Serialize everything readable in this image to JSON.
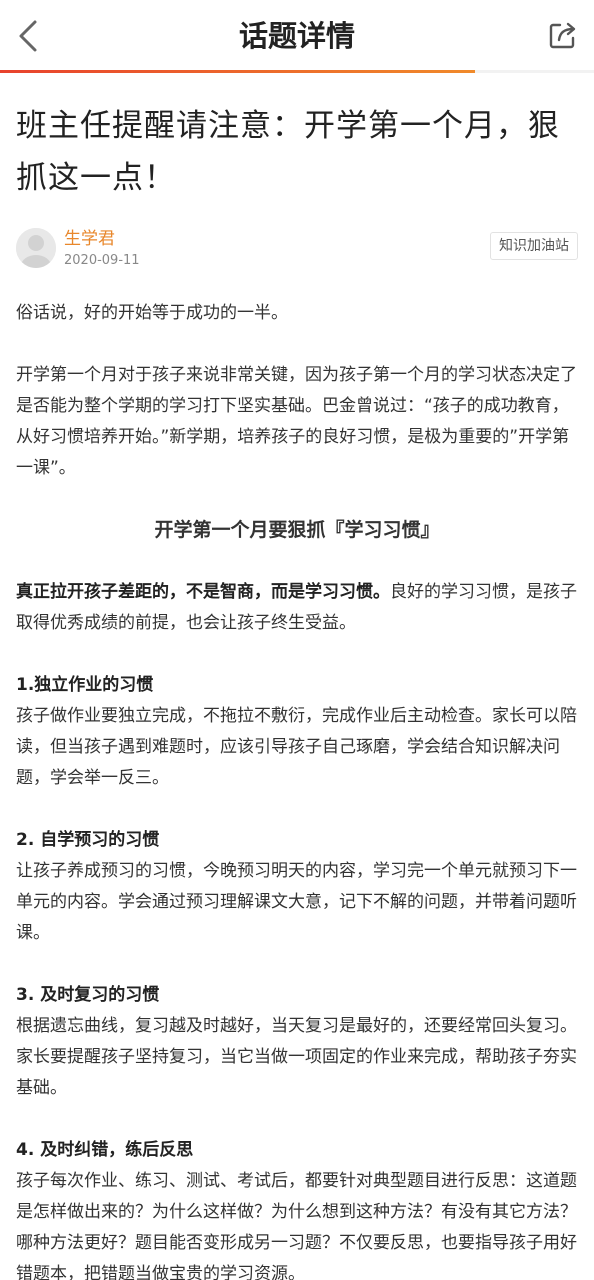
{
  "header": {
    "title": "话题详情",
    "back_icon": "chevron-left-icon",
    "share_icon": "share-icon",
    "read_progress": 0.8,
    "accent_color": "#e8422d"
  },
  "article": {
    "title": "班主任提醒请注意：开学第一个月，狠抓这一点！",
    "author": {
      "name": "生学君",
      "date": "2020-09-11",
      "avatar_icon": "default-avatar-icon"
    },
    "tag": "知识加油站",
    "intro": "俗话说，好的开始等于成功的一半。",
    "para1": "开学第一个月对于孩子来说非常关键，因为孩子第一个月的学习状态决定了是否能为整个学期的学习打下坚实基础。巴金曾说过：“孩子的成功教育，从好习惯培养开始。”新学期，培养孩子的良好习惯，是极为重要的”开学第一课”。",
    "subheading": "开学第一个月要狠抓『学习习惯』",
    "para2_bold": "真正拉开孩子差距的，不是智商，而是学习习惯。",
    "para2_rest": "良好的学习习惯，是孩子取得优秀成绩的前提，也会让孩子终生受益。",
    "sections": [
      {
        "title": "1.独立作业的习惯",
        "text": "孩子做作业要独立完成，不拖拉不敷衍，完成作业后主动检查。家长可以陪读，但当孩子遇到难题时，应该引导孩子自己琢磨，学会结合知识解决问题，学会举一反三。"
      },
      {
        "title": "2. 自学预习的习惯",
        "text": "让孩子养成预习的习惯，今晚预习明天的内容，学习完一个单元就预习下一单元的内容。学会通过预习理解课文大意，记下不解的问题，并带着问题听课。"
      },
      {
        "title": "3. 及时复习的习惯",
        "text": "根据遗忘曲线，复习越及时越好，当天复习是最好的，还要经常回头复习。家长要提醒孩子坚持复习，当它当做一项固定的作业来完成，帮助孩子夯实基础。"
      },
      {
        "title": "4. 及时纠错，练后反思",
        "text": "孩子每次作业、练习、测试、考试后，都要针对典型题目进行反思：这道题是怎样做出来的？为什么这样做？为什么想到这种方法？有没有其它方法？哪种方法更好？题目能否变形成另一习题？不仅要反思，也要指导孩子用好错题本，把错题当做宝贵的学习资源。"
      }
    ]
  }
}
